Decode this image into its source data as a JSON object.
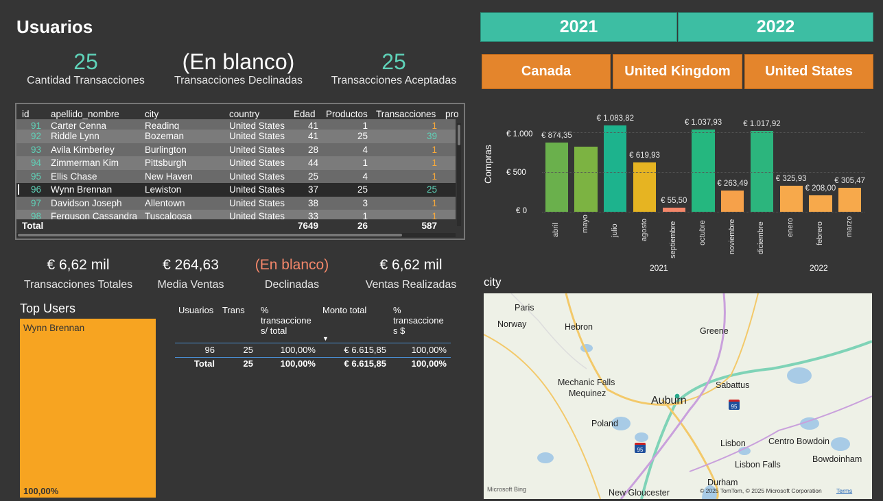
{
  "header": {
    "title": "Usuarios"
  },
  "years": [
    "2021",
    "2022"
  ],
  "countries": [
    "Canada",
    "United Kingdom",
    "United States"
  ],
  "kpis_top": [
    {
      "value": "25",
      "label": "Cantidad Transacciones"
    },
    {
      "value": "(En blanco)",
      "label": "Transacciones Declinadas"
    },
    {
      "value": "25",
      "label": "Transacciones Aceptadas"
    }
  ],
  "users_table": {
    "columns": [
      "id",
      "apellido_nombre",
      "city",
      "country",
      "Edad",
      "Productos",
      "Transacciones",
      "pro"
    ],
    "partial_row": {
      "id": "91",
      "name": "Carter Cenna",
      "city": "Reading",
      "country": "United States",
      "edad": "41",
      "productos": "1",
      "trans": "1"
    },
    "rows": [
      {
        "id": "92",
        "name": "Riddle Lynn",
        "city": "Bozeman",
        "country": "United States",
        "edad": "41",
        "productos": "25",
        "trans": "39"
      },
      {
        "id": "93",
        "name": "Avila Kimberley",
        "city": "Burlington",
        "country": "United States",
        "edad": "28",
        "productos": "4",
        "trans": "1"
      },
      {
        "id": "94",
        "name": "Zimmerman Kim",
        "city": "Pittsburgh",
        "country": "United States",
        "edad": "44",
        "productos": "1",
        "trans": "1"
      },
      {
        "id": "95",
        "name": "Ellis Chase",
        "city": "New Haven",
        "country": "United States",
        "edad": "25",
        "productos": "4",
        "trans": "1"
      },
      {
        "id": "96",
        "name": "Wynn Brennan",
        "city": "Lewiston",
        "country": "United States",
        "edad": "37",
        "productos": "25",
        "trans": "25"
      },
      {
        "id": "97",
        "name": "Davidson Joseph",
        "city": "Allentown",
        "country": "United States",
        "edad": "38",
        "productos": "3",
        "trans": "1"
      },
      {
        "id": "98",
        "name": "Ferguson Cassandra",
        "city": "Tuscaloosa",
        "country": "United States",
        "edad": "33",
        "productos": "1",
        "trans": "1"
      }
    ],
    "total": {
      "label": "Total",
      "edad": "7649",
      "productos": "26",
      "trans": "587"
    }
  },
  "kpis_bottom": [
    {
      "value": "€ 6,62 mil",
      "label": "Transacciones Totales"
    },
    {
      "value": "€ 264,63",
      "label": "Media Ventas"
    },
    {
      "value": "(En blanco)",
      "label": "Declinadas"
    },
    {
      "value": "€ 6,62 mil",
      "label": "Ventas Realizadas"
    }
  ],
  "top_users": {
    "title": "Top Users",
    "name": "Wynn Brennan",
    "pct": "100,00%"
  },
  "trans_table": {
    "headers": [
      "Usuarios",
      "Trans",
      "% transaccione s/ total",
      "Monto total",
      "% transaccione s $"
    ],
    "row": [
      "96",
      "25",
      "100,00%",
      "€ 6.615,85",
      "100,00%"
    ],
    "total": [
      "Total",
      "25",
      "100,00%",
      "€ 6.615,85",
      "100,00%"
    ]
  },
  "chart_data": {
    "type": "bar",
    "ylabel": "Compras",
    "yticks": [
      "€ 0",
      "€ 500",
      "€ 1.000"
    ],
    "ylim": [
      0,
      1200
    ],
    "categories": [
      "abril",
      "mayo",
      "julio",
      "agosto",
      "septiembre",
      "octubre",
      "noviembre",
      "diciembre",
      "enero",
      "febrero",
      "marzo"
    ],
    "groups": [
      {
        "label": "2021",
        "count": 8
      },
      {
        "label": "2022",
        "count": 3
      }
    ],
    "values": [
      874.35,
      820,
      1083.82,
      619.93,
      55.5,
      1037.93,
      263.49,
      1017.92,
      325.93,
      208.0,
      305.47
    ],
    "data_labels": [
      "€ 874,35",
      "",
      "€ 1.083,82",
      "€ 619,93",
      "€ 55,50",
      "€ 1.037,93",
      "€ 263,49",
      "€ 1.017,92",
      "€ 325,93",
      "€ 208,00",
      "€ 305,47"
    ],
    "colors": [
      "#6ab04c",
      "#7cb342",
      "#1db38d",
      "#e6b422",
      "#f4876a",
      "#25b77f",
      "#f6a14a",
      "#2cb57d",
      "#f7a94b",
      "#f7a94b",
      "#f7a94b"
    ]
  },
  "map": {
    "title": "city",
    "labels": [
      "Paris",
      "Norway",
      "Hebron",
      "Greene",
      "Mechanic Falls",
      "Mequinez",
      "Sabattus",
      "Auburn",
      "Poland",
      "Lisbon",
      "Centro Bowdoin",
      "Bowdoinham",
      "Lisbon Falls",
      "Durham",
      "New Gloucester"
    ],
    "route_labels": [
      "95",
      "95"
    ],
    "attribution": "© 2025 TomTom, © 2025 Microsoft Corporation",
    "terms": "Terms",
    "brand": "Microsoft Bing"
  }
}
